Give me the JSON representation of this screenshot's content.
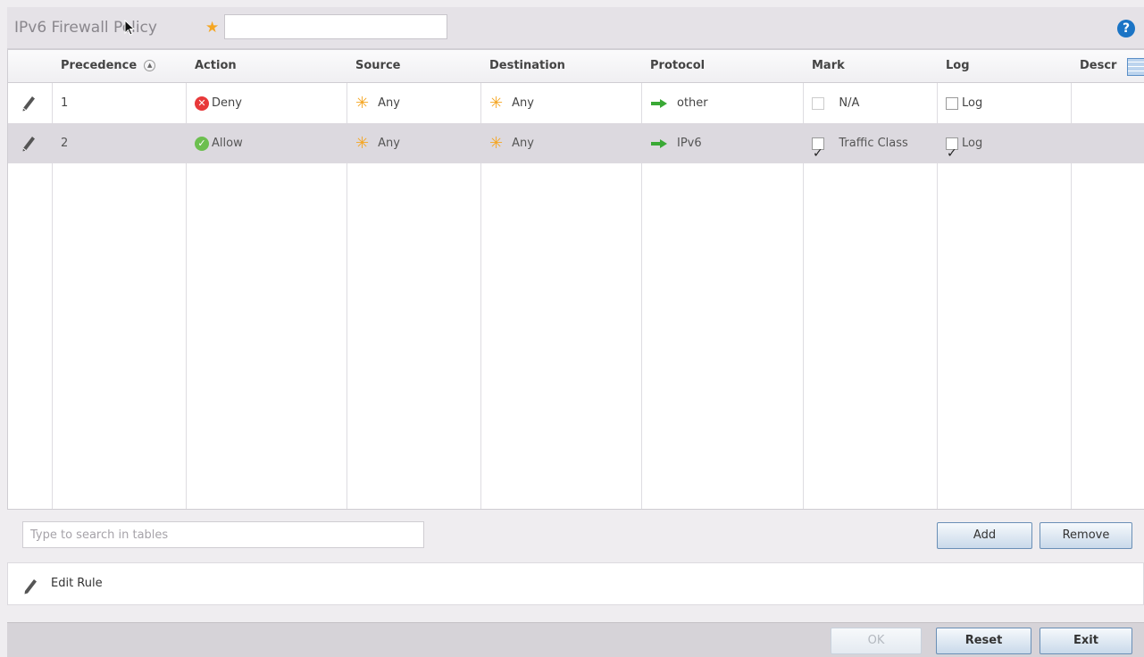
{
  "header": {
    "title": "IPv6 Firewall Policy",
    "required_marker": "★",
    "name_value": "",
    "help_label": "?"
  },
  "table": {
    "columns": [
      "Precedence",
      "Action",
      "Source",
      "Destination",
      "Protocol",
      "Mark",
      "Log",
      "Descr"
    ],
    "sort_indicator": "▲",
    "rows": [
      {
        "precedence": "1",
        "action": "Deny",
        "action_status": "deny",
        "source": "Any",
        "destination": "Any",
        "protocol": "other",
        "mark": "N/A",
        "mark_checked": false,
        "mark_enabled": false,
        "log": "Log",
        "log_checked": false,
        "selected": false
      },
      {
        "precedence": "2",
        "action": "Allow",
        "action_status": "allow",
        "source": "Any",
        "destination": "Any",
        "protocol": "IPv6",
        "mark": "Traffic Class",
        "mark_checked": true,
        "mark_enabled": true,
        "log": "Log",
        "log_checked": true,
        "selected": true
      }
    ]
  },
  "search": {
    "placeholder": "Type to search in tables",
    "value": ""
  },
  "buttons": {
    "add": "Add",
    "remove": "Remove",
    "ok": "OK",
    "reset": "Reset",
    "exit": "Exit"
  },
  "edit_bar": {
    "label": "Edit Rule"
  },
  "colors": {
    "deny": "#e8393a",
    "allow": "#6cbf4f",
    "any": "#f5a623",
    "protocol_arrow": "#3aa935",
    "help": "#1b74c5"
  }
}
